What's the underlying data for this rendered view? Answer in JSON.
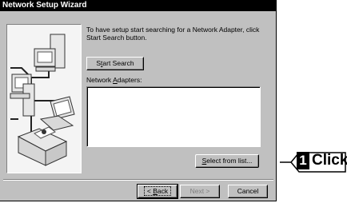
{
  "window": {
    "title": "Network Setup Wizard"
  },
  "instructions": "To have setup start searching for a Network Adapter, click Start Search button.",
  "start_search": {
    "pre": "S",
    "key": "t",
    "post": "art Search"
  },
  "adapters_label": {
    "pre": "Network ",
    "key": "A",
    "post": "dapters:"
  },
  "select_from_list": {
    "key": "S",
    "post": "elect from list..."
  },
  "buttons": {
    "back": {
      "pre": "< ",
      "key": "B",
      "post": "ack"
    },
    "next": "Next >",
    "cancel": "Cancel"
  },
  "annotation": {
    "number": "1",
    "text": "Click"
  },
  "icons": [
    "computer-icon",
    "network-cable-icon",
    "laptop-icon",
    "printer-icon"
  ]
}
